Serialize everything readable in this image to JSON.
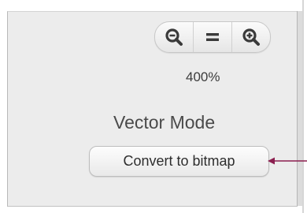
{
  "zoom": {
    "zoom_out_icon": "zoom-out-icon",
    "reset_icon": "equals-icon",
    "zoom_in_icon": "zoom-in-icon",
    "level": "400%"
  },
  "mode": {
    "label": "Vector Mode"
  },
  "convert": {
    "label": "Convert to bitmap"
  },
  "annotation": {
    "arrow_color": "#8b1f4f"
  }
}
